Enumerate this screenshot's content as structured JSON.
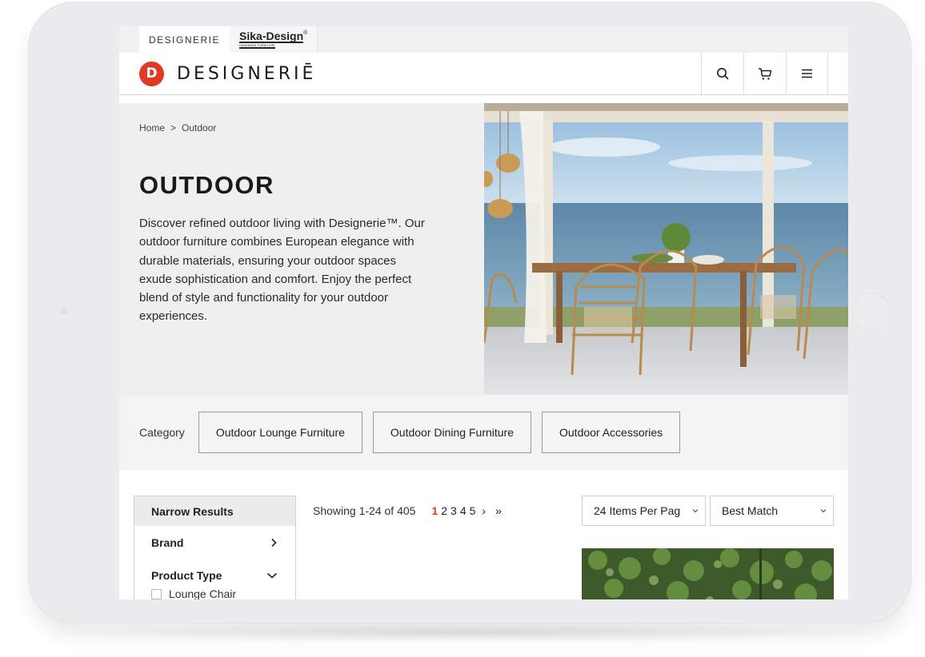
{
  "brand_tabs": [
    {
      "label": "DESIGNERIE"
    },
    {
      "label": "Sika-Design",
      "trademark": "®",
      "sublabel": "HANDMADE FURNITURE"
    }
  ],
  "header": {
    "logo_mark": "D",
    "logo_text": "DESIGNERIĒ",
    "icons": [
      "search-icon",
      "cart-icon",
      "menu-icon"
    ]
  },
  "breadcrumb": {
    "home": "Home",
    "separator": ">",
    "current": "Outdoor"
  },
  "hero": {
    "title": "OUTDOOR",
    "description": "Discover refined outdoor living with Designerie™. Our outdoor furniture combines European elegance with durable materials, ensuring your outdoor spaces exude sophistication and comfort. Enjoy the perfect blend of style and functionality for your outdoor experiences."
  },
  "category": {
    "label": "Category",
    "buttons": [
      "Outdoor Lounge Furniture",
      "Outdoor Dining Furniture",
      "Outdoor Accessories"
    ]
  },
  "narrow_results": {
    "title": "Narrow Results",
    "filters": [
      {
        "label": "Brand",
        "icon": "chevron-right-icon"
      },
      {
        "label": "Product Type",
        "icon": "chevron-down-icon"
      }
    ],
    "options": [
      "Lounge Chair"
    ]
  },
  "results": {
    "showing": "Showing 1-24 of 405",
    "pages": [
      "1",
      "2",
      "3",
      "4",
      "5"
    ],
    "current_page": "1",
    "next": "›",
    "last": "»"
  },
  "per_page": {
    "selected": "24 Items Per Pag"
  },
  "sort": {
    "selected": "Best Match"
  },
  "colors": {
    "accent": "#e03a25",
    "hero_bg": "#efefef",
    "category_bg": "#f3f3f3"
  }
}
